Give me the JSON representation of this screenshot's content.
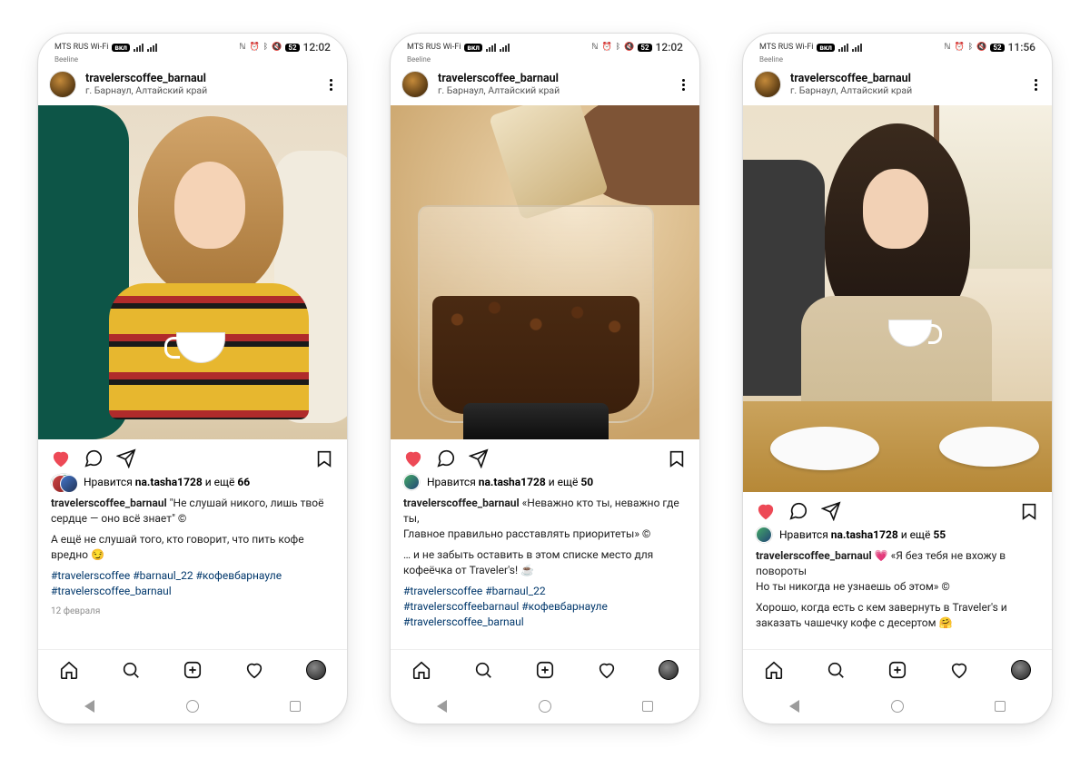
{
  "phones": [
    {
      "status": {
        "carrier": "MTS RUS Wi-Fi",
        "badge": "вкл",
        "sub": "Beeline",
        "batt": "52",
        "time": "12:02"
      },
      "header": {
        "username": "travelerscoffee_barnaul",
        "location": "г. Барнаул, Алтайский край"
      },
      "likes": {
        "prefix": "Нравится ",
        "name": "na.tasha1728",
        "mid": " и ещё ",
        "count": "66"
      },
      "caption": {
        "author": "travelerscoffee_barnaul",
        "line1": " \"Не слушай никого, лишь твоё сердце — оно всё знает\" ©",
        "line2": "А ещё не слушай того, кто говорит, что пить кофе вредно 😏",
        "tags1": "#travelerscoffee #barnaul_22 #кофевбарнауле",
        "tags2": "#travelerscoffee_barnaul"
      },
      "date": "12 февраля"
    },
    {
      "status": {
        "carrier": "MTS RUS Wi-Fi",
        "badge": "вкл",
        "sub": "Beeline",
        "batt": "52",
        "time": "12:02"
      },
      "header": {
        "username": "travelerscoffee_barnaul",
        "location": "г. Барнаул, Алтайский край"
      },
      "likes": {
        "prefix": "Нравится ",
        "name": "na.tasha1728",
        "mid": " и ещё ",
        "count": "50"
      },
      "caption": {
        "author": "travelerscoffee_barnaul",
        "line1": " «Неважно кто ты, неважно где ты,",
        "line1b": "Главное правильно расставлять приоритеты» ©",
        "line2": "… и не забыть оставить в этом списке место для кофеёчка от Traveler's! ☕",
        "tags1": "#travelerscoffee #barnaul_22",
        "tags2": "#travelerscoffeebarnaul #кофевбарнауле",
        "tags3": "#travelerscoffee_barnaul"
      }
    },
    {
      "status": {
        "carrier": "MTS RUS Wi-Fi",
        "badge": "вкл",
        "sub": "Beeline",
        "batt": "52",
        "time": "11:56"
      },
      "header": {
        "username": "travelerscoffee_barnaul",
        "location": "г. Барнаул, Алтайский край"
      },
      "likes": {
        "prefix": "Нравится ",
        "name": "na.tasha1728",
        "mid": " и ещё ",
        "count": "55"
      },
      "caption": {
        "author": "travelerscoffee_barnaul",
        "line1": " 💗 «Я без тебя не вхожу в повороты",
        "line1b": "Но ты никогда не узнаешь об этом» ©",
        "line2": "Хорошо, когда есть с кем завернуть в Traveler's и заказать чашечку кофе с десертом 🤗"
      }
    }
  ]
}
